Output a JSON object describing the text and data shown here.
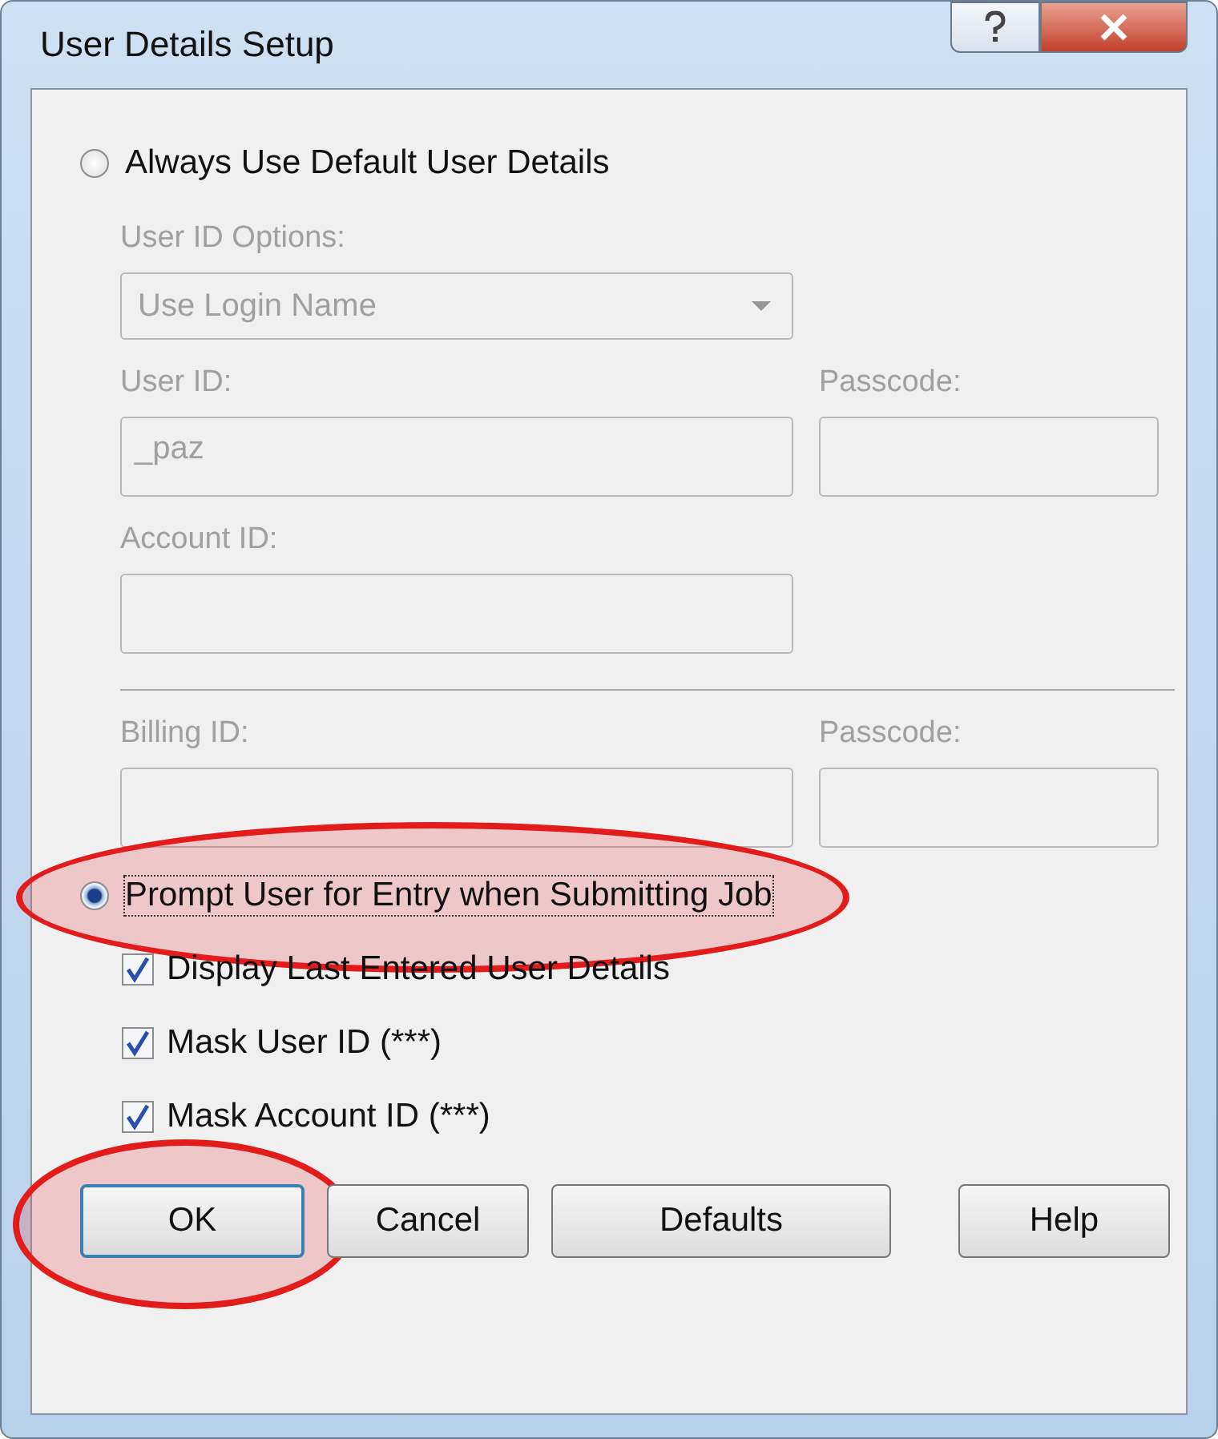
{
  "window": {
    "title": "User Details Setup"
  },
  "options": [
    {
      "label": "Always Use Default User Details",
      "selected": false,
      "highlighted": false
    },
    {
      "label": "Prompt User for Entry when Submitting Job",
      "selected": true,
      "highlighted": true
    }
  ],
  "default_details": {
    "disabled": true,
    "user_id_options": {
      "label": "User ID Options:",
      "value": "Use Login Name"
    },
    "user_id": {
      "label": "User ID:",
      "value": "_paz"
    },
    "passcode": {
      "label": "Passcode:"
    },
    "account_id": {
      "label": "Account ID:"
    },
    "billing_id": {
      "label": "Billing ID:"
    },
    "billing_passcode": {
      "label": "Passcode:"
    }
  },
  "checkboxes": [
    {
      "label": "Display Last Entered User Details",
      "checked": true
    },
    {
      "label": "Mask User ID (***)",
      "checked": true
    },
    {
      "label": "Mask Account ID (***)",
      "checked": true
    }
  ],
  "buttons": [
    {
      "label": "OK",
      "default": true,
      "highlighted": true
    },
    {
      "label": "Cancel",
      "default": false,
      "highlighted": false
    },
    {
      "label": "Defaults",
      "default": false,
      "highlighted": false
    },
    {
      "label": "Help",
      "default": false,
      "highlighted": false
    }
  ]
}
